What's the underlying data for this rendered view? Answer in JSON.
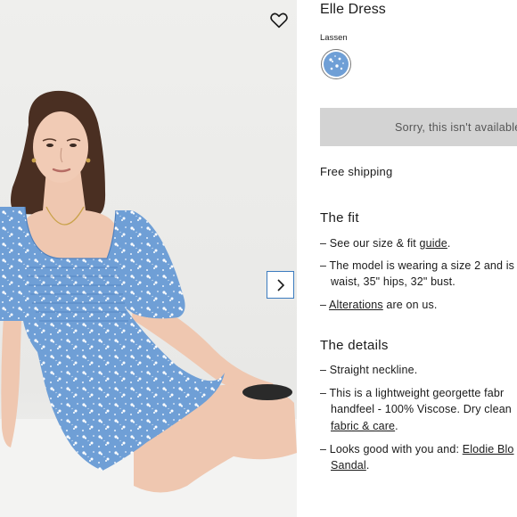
{
  "product": {
    "title": "Elle Dress",
    "color_name": "Lassen",
    "sold_out_text": "Sorry, this isn't available",
    "shipping_text": "Free shipping"
  },
  "icons": {
    "wishlist": "heart-outline-icon",
    "next": "chevron-right-icon"
  },
  "colors": {
    "dress_blue": "#6f9fd6",
    "disabled_button": "#d3d3d3",
    "next_button_border": "#3b7bbf"
  },
  "fit": {
    "heading": "The fit",
    "item1_prefix": "– See our size & fit ",
    "item1_link": "guide",
    "item1_suffix": ".",
    "item2_line1": "– The model is wearing a size 2 and is",
    "item2_line2": "waist, 35\" hips, 32\" bust.",
    "item3_prefix": "– ",
    "item3_link": "Alterations",
    "item3_suffix": " are on us."
  },
  "details": {
    "heading": "The details",
    "item1": "– Straight neckline.",
    "item2_line1": "– This is a lightweight georgette fabr",
    "item2_line2": "handfeel - 100% Viscose. Dry clean",
    "item2_link": "fabric & care",
    "item2_suffix": ".",
    "item3_prefix": "– Looks good with you and: ",
    "item3_link1": "Elodie Blo",
    "item3_link2": "Sandal",
    "item3_suffix": "."
  }
}
